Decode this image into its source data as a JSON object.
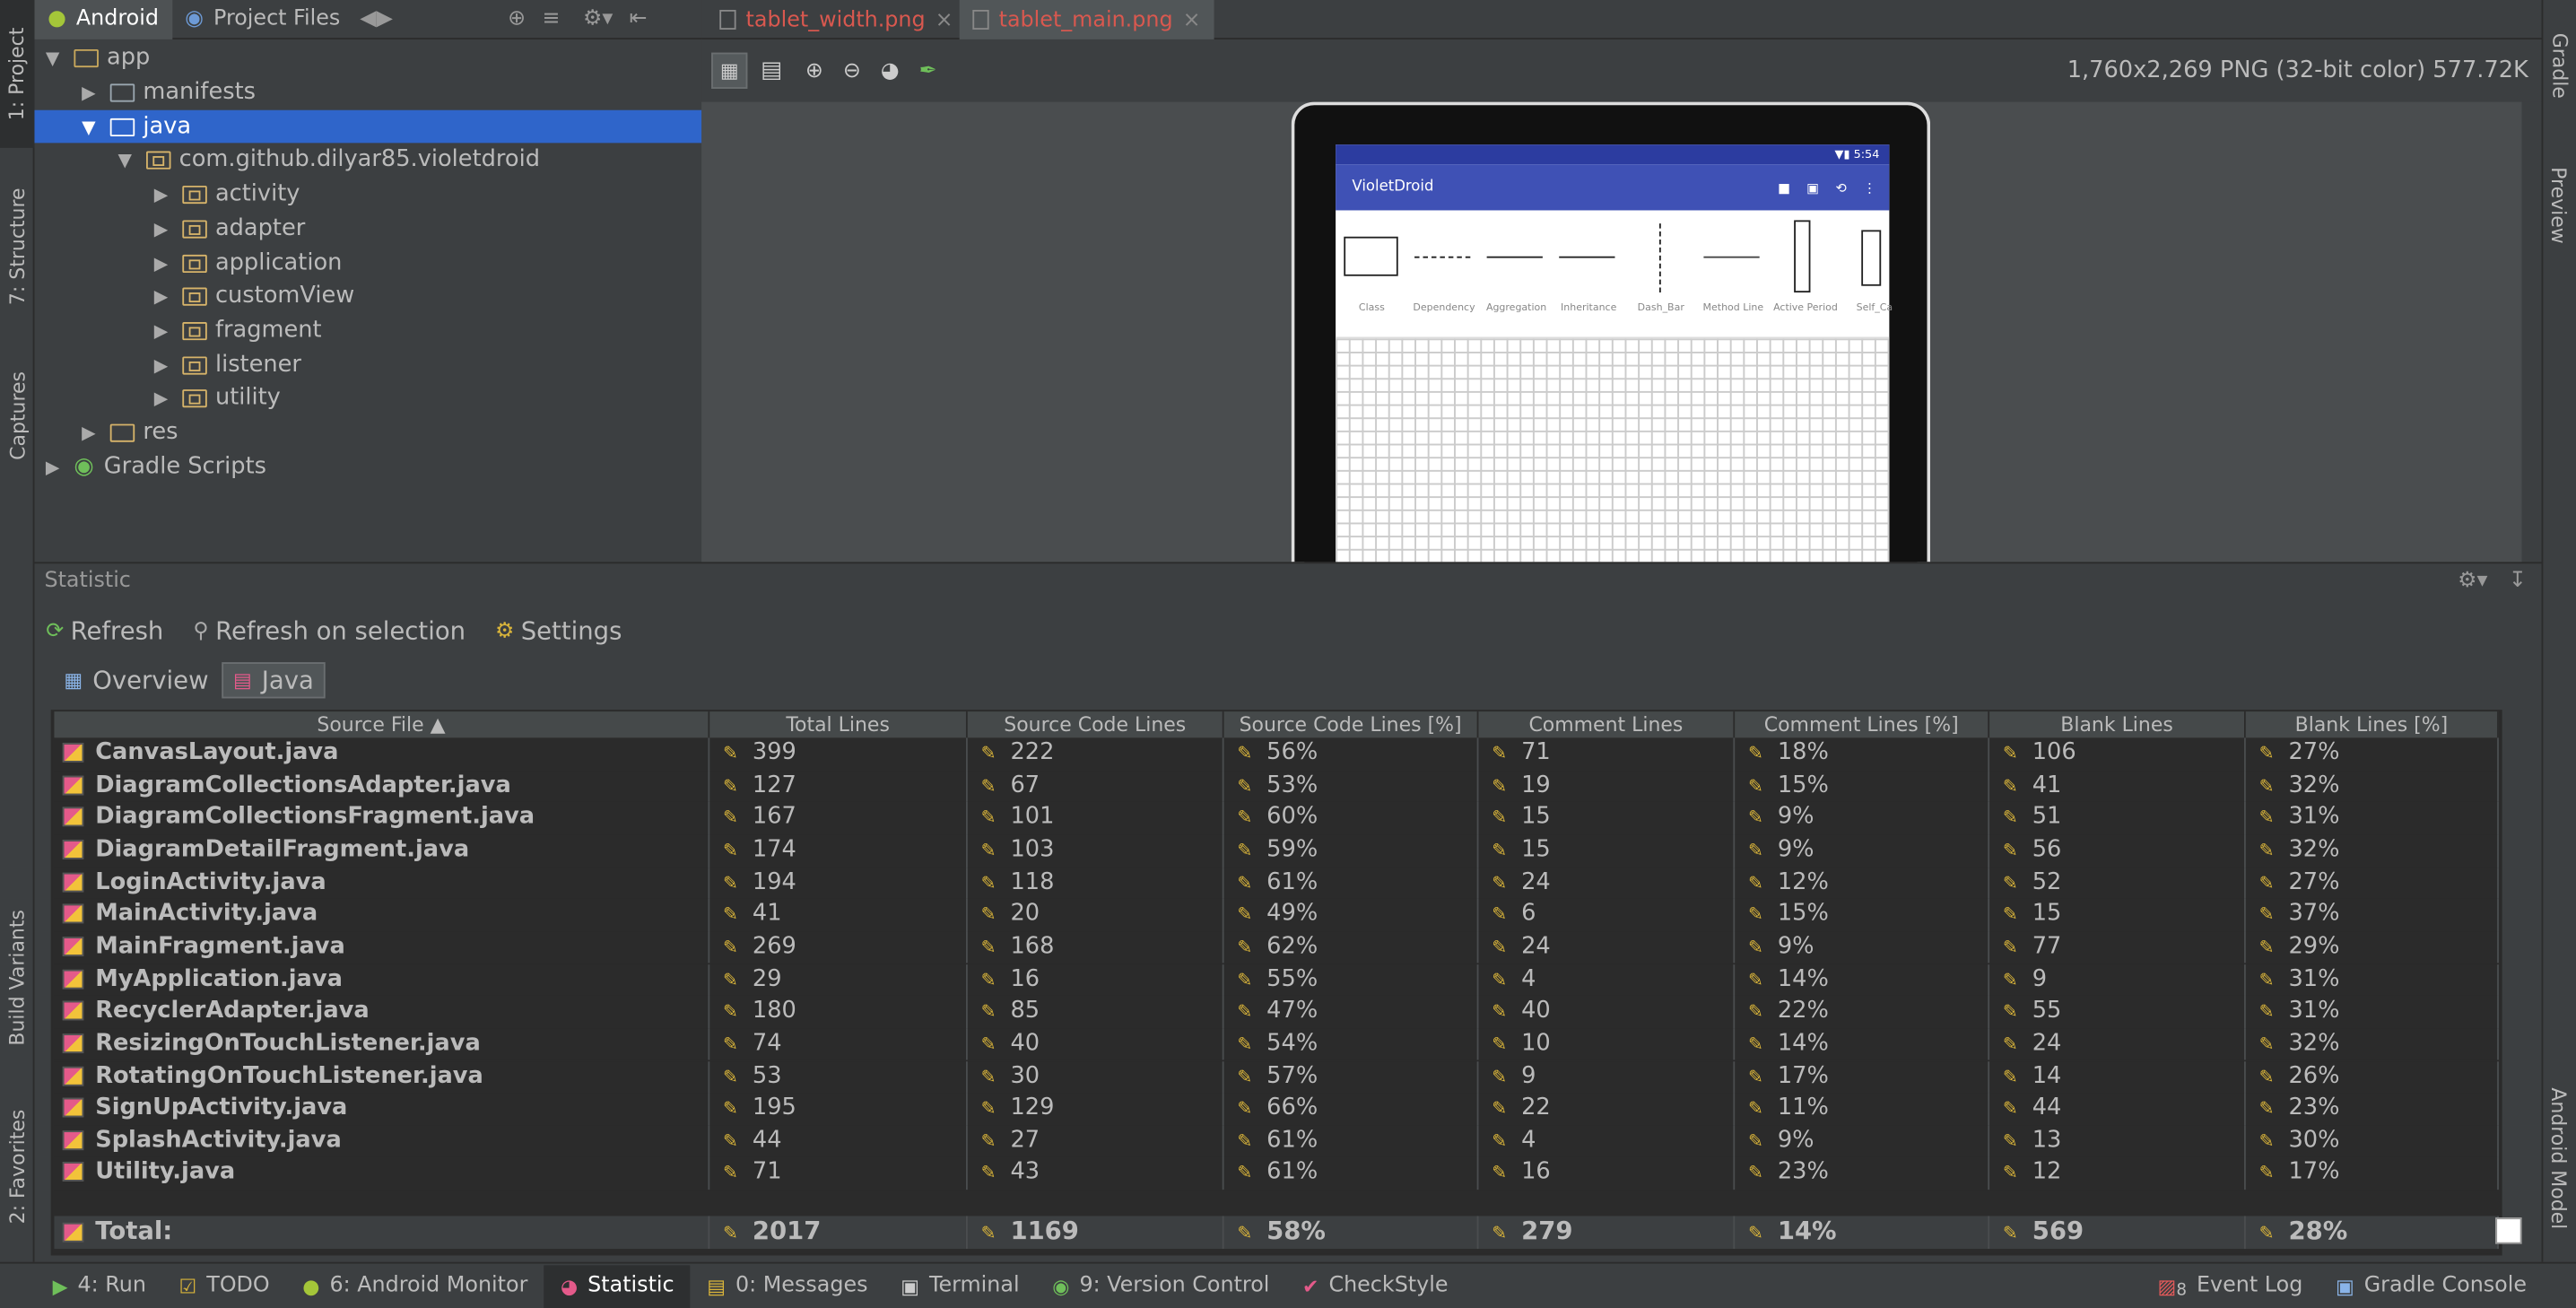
{
  "left_strip": {
    "tabs": [
      "1: Project",
      "7: Structure",
      "Captures",
      "Build Variants",
      "2: Favorites"
    ]
  },
  "right_strip": {
    "tabs": [
      "Gradle",
      "Preview",
      "Android Model"
    ]
  },
  "project_panel": {
    "view_selector": "Android",
    "view_alt": "Project Files",
    "tree": [
      {
        "label": "app",
        "depth": 0,
        "expanded": true,
        "kind": "module"
      },
      {
        "label": "manifests",
        "depth": 1,
        "expanded": false,
        "kind": "folder"
      },
      {
        "label": "java",
        "depth": 1,
        "expanded": true,
        "kind": "folder",
        "selected": true
      },
      {
        "label": "com.github.dilyar85.violetdroid",
        "depth": 2,
        "expanded": true,
        "kind": "package"
      },
      {
        "label": "activity",
        "depth": 3,
        "expanded": false,
        "kind": "package"
      },
      {
        "label": "adapter",
        "depth": 3,
        "expanded": false,
        "kind": "package"
      },
      {
        "label": "application",
        "depth": 3,
        "expanded": false,
        "kind": "package"
      },
      {
        "label": "customView",
        "depth": 3,
        "expanded": false,
        "kind": "package"
      },
      {
        "label": "fragment",
        "depth": 3,
        "expanded": false,
        "kind": "package"
      },
      {
        "label": "listener",
        "depth": 3,
        "expanded": false,
        "kind": "package"
      },
      {
        "label": "utility",
        "depth": 3,
        "expanded": false,
        "kind": "package"
      },
      {
        "label": "res",
        "depth": 1,
        "expanded": false,
        "kind": "res"
      },
      {
        "label": "Gradle Scripts",
        "depth": 0,
        "expanded": false,
        "kind": "gradle"
      }
    ]
  },
  "editor": {
    "tabs": [
      {
        "label": "tablet_width.png",
        "active": false
      },
      {
        "label": "tablet_main.png",
        "active": true
      }
    ],
    "image_info": "1,760x2,269 PNG (32-bit color) 577.72K",
    "preview": {
      "status_time": "5:54",
      "app_title": "VioletDroid",
      "palette": [
        "Class",
        "Dependency",
        "Aggregation",
        "Inheritance",
        "Dash_Bar",
        "Method Line",
        "Active Period",
        "Self_Ca"
      ]
    }
  },
  "statistic": {
    "panel_title": "Statistic",
    "toolbar": {
      "refresh": "Refresh",
      "refresh_selection": "Refresh on selection",
      "settings": "Settings"
    },
    "tabs": [
      {
        "label": "Overview",
        "active": false
      },
      {
        "label": "Java",
        "active": true
      }
    ],
    "columns": [
      "Source File ▲",
      "Total Lines",
      "Source Code Lines",
      "Source Code Lines [%]",
      "Comment Lines",
      "Comment Lines [%]",
      "Blank Lines",
      "Blank Lines [%]"
    ],
    "rows": [
      [
        "CanvasLayout.java",
        "399",
        "222",
        "56%",
        "71",
        "18%",
        "106",
        "27%"
      ],
      [
        "DiagramCollectionsAdapter.java",
        "127",
        "67",
        "53%",
        "19",
        "15%",
        "41",
        "32%"
      ],
      [
        "DiagramCollectionsFragment.java",
        "167",
        "101",
        "60%",
        "15",
        "9%",
        "51",
        "31%"
      ],
      [
        "DiagramDetailFragment.java",
        "174",
        "103",
        "59%",
        "15",
        "9%",
        "56",
        "32%"
      ],
      [
        "LoginActivity.java",
        "194",
        "118",
        "61%",
        "24",
        "12%",
        "52",
        "27%"
      ],
      [
        "MainActivity.java",
        "41",
        "20",
        "49%",
        "6",
        "15%",
        "15",
        "37%"
      ],
      [
        "MainFragment.java",
        "269",
        "168",
        "62%",
        "24",
        "9%",
        "77",
        "29%"
      ],
      [
        "MyApplication.java",
        "29",
        "16",
        "55%",
        "4",
        "14%",
        "9",
        "31%"
      ],
      [
        "RecyclerAdapter.java",
        "180",
        "85",
        "47%",
        "40",
        "22%",
        "55",
        "31%"
      ],
      [
        "ResizingOnTouchListener.java",
        "74",
        "40",
        "54%",
        "10",
        "14%",
        "24",
        "32%"
      ],
      [
        "RotatingOnTouchListener.java",
        "53",
        "30",
        "57%",
        "9",
        "17%",
        "14",
        "26%"
      ],
      [
        "SignUpActivity.java",
        "195",
        "129",
        "66%",
        "22",
        "11%",
        "44",
        "23%"
      ],
      [
        "SplashActivity.java",
        "44",
        "27",
        "61%",
        "4",
        "9%",
        "13",
        "30%"
      ],
      [
        "Utility.java",
        "71",
        "43",
        "61%",
        "16",
        "23%",
        "12",
        "17%"
      ]
    ],
    "total": [
      "Total:",
      "2017",
      "1169",
      "58%",
      "279",
      "14%",
      "569",
      "28%"
    ]
  },
  "bottom_bar": {
    "tabs": [
      {
        "label": "4: Run",
        "icon": "run-icon"
      },
      {
        "label": "TODO",
        "icon": "todo-icon"
      },
      {
        "label": "6: Android Monitor",
        "icon": "android-icon"
      },
      {
        "label": "Statistic",
        "icon": "statistic-icon",
        "active": true
      },
      {
        "label": "0: Messages",
        "icon": "messages-icon"
      },
      {
        "label": "Terminal",
        "icon": "terminal-icon"
      },
      {
        "label": "9: Version Control",
        "icon": "vcs-icon"
      },
      {
        "label": "CheckStyle",
        "icon": "checkstyle-icon"
      }
    ],
    "right_tabs": [
      {
        "label": "Event Log",
        "badge": "8"
      },
      {
        "label": "Gradle Console"
      }
    ]
  }
}
